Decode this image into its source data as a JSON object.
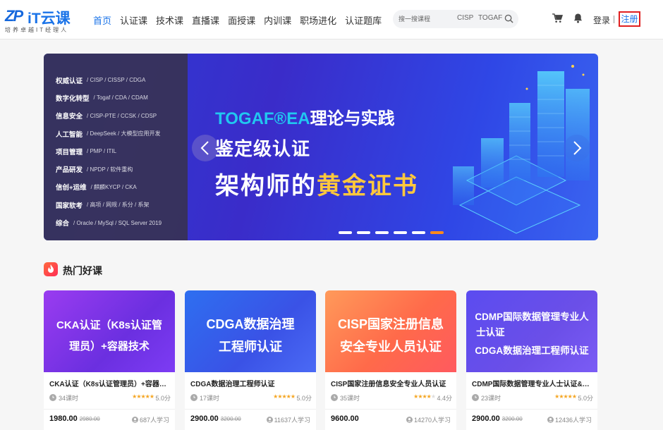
{
  "header": {
    "logo_mark": "ZP",
    "logo_name": "iT云课",
    "logo_slogan": "培养卓越IT经理人",
    "nav": [
      "首页",
      "认证课",
      "技术课",
      "直播课",
      "面授课",
      "内训课",
      "职场进化",
      "认证题库"
    ],
    "search_placeholder": "搜一搜课程",
    "hot_keywords": [
      "CISP",
      "TOGAF"
    ],
    "login": "登录",
    "register": "注册"
  },
  "banner": {
    "categories": [
      {
        "name": "权威认证",
        "subs": "/ CISP / CISSP / CDGA"
      },
      {
        "name": "数字化转型",
        "subs": "/ Togaf / CDA / CDAM"
      },
      {
        "name": "信息安全",
        "subs": "/ CISP-PTE / CCSK / CDSP"
      },
      {
        "name": "人工智能",
        "subs": "/ DeepSeek / 大模型应用开发"
      },
      {
        "name": "项目管理",
        "subs": "/ PMP / ITIL"
      },
      {
        "name": "产品研发",
        "subs": "/ NPDP / 软件重构"
      },
      {
        "name": "信创+运维",
        "subs": "/ 麒麟KYCP / CKA"
      },
      {
        "name": "国家软考",
        "subs": "/ 高项 / 网规 / 系分 / 系架"
      },
      {
        "name": "综合",
        "subs": "/ Oracle / MySql / SQL Server 2019"
      }
    ],
    "headline_hl": "TOGAF®EA",
    "headline_rest": "理论与实践",
    "line2": "鉴定级认证",
    "line3_a": "架构师的",
    "line3_b": "黄金证书",
    "slides": 6,
    "active_slide": 6
  },
  "section_title": "热门好课",
  "courses": [
    {
      "cover_l1": "CKA认证（K8s认证管",
      "cover_l2": "理员）+容器技术",
      "title": "CKA认证（K8s认证管理员）+容器技术",
      "lessons": "34课时",
      "score": "5.0分",
      "price": "1980.00",
      "old_price": "2980.00",
      "learners": "687人学习"
    },
    {
      "cover_l1": "CDGA数据治理",
      "cover_l2": "工程师认证",
      "title": "CDGA数据治理工程师认证",
      "lessons": "17课时",
      "score": "5.0分",
      "price": "2900.00",
      "old_price": "3200.00",
      "learners": "11637人学习"
    },
    {
      "cover_l1": "CISP国家注册信息",
      "cover_l2": "安全专业人员认证",
      "title": "CISP国家注册信息安全专业人员认证",
      "lessons": "35课时",
      "score": "4.4分",
      "price": "9600.00",
      "old_price": "",
      "learners": "14270人学习"
    },
    {
      "cover_l1": "CDMP国际数据管理专业人",
      "cover_l2": "士认证",
      "cover_l3": "CDGA数据治理工程师认证",
      "title": "CDMP国际数据管理专业人士认证&CD...",
      "lessons": "23课时",
      "score": "5.0分",
      "price": "2900.00",
      "old_price": "3200.00",
      "learners": "12436人学习"
    }
  ],
  "colors": {
    "brand": "#1a73e8",
    "register_border": "#e02020",
    "star": "#f5a623",
    "slide_active": "#ff8a1c"
  }
}
